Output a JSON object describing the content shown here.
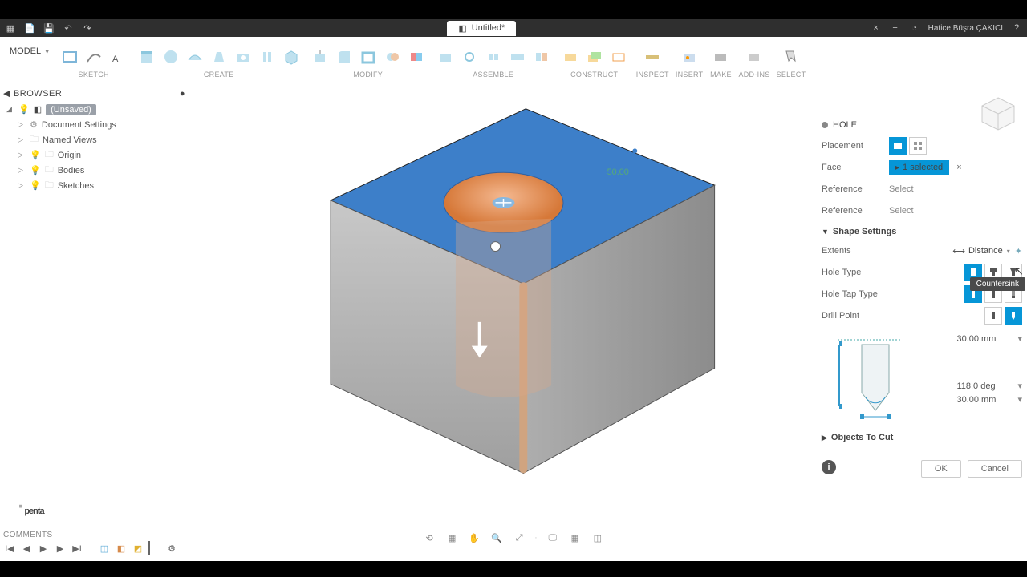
{
  "qa": {
    "doc_title": "Untitled*",
    "user": "Hatice Büşra ÇAKICI"
  },
  "ribbon": {
    "model": "MODEL",
    "groups": {
      "sketch": "SKETCH",
      "create": "CREATE",
      "modify": "MODIFY",
      "assemble": "ASSEMBLE",
      "construct": "CONSTRUCT",
      "inspect": "INSPECT",
      "insert": "INSERT",
      "make": "MAKE",
      "addins": "ADD-INS",
      "select": "SELECT"
    }
  },
  "browser": {
    "title": "BROWSER",
    "nodes": [
      {
        "label": "(Unsaved)",
        "selected": true,
        "icon": "bulb",
        "exp": true
      },
      {
        "label": "Document Settings",
        "icon": "gear"
      },
      {
        "label": "Named Views",
        "icon": "folder"
      },
      {
        "label": "Origin",
        "icon": "folder",
        "bulb": true
      },
      {
        "label": "Bodies",
        "icon": "folder",
        "bulb": true
      },
      {
        "label": "Sketches",
        "icon": "folder",
        "bulb": true
      }
    ]
  },
  "canvas": {
    "dim": "50.00"
  },
  "panel": {
    "title": "HOLE",
    "placement_label": "Placement",
    "face_label": "Face",
    "face_chip": "1 selected",
    "reference_label": "Reference",
    "reference_value": "Select",
    "shape_hdr": "Shape Settings",
    "extents_label": "Extents",
    "extents_value": "Distance",
    "holetype_label": "Hole Type",
    "holetap_label": "Hole Tap Type",
    "drillpoint_label": "Drill Point",
    "tooltip": "Countersink",
    "dims": {
      "depth": "30.00 mm",
      "angle": "118.0 deg",
      "dia": "30.00 mm"
    },
    "objects_hdr": "Objects To Cut",
    "ok": "OK",
    "cancel": "Cancel"
  },
  "timeline": {
    "comments": "COMMENTS"
  },
  "logo": "penta"
}
